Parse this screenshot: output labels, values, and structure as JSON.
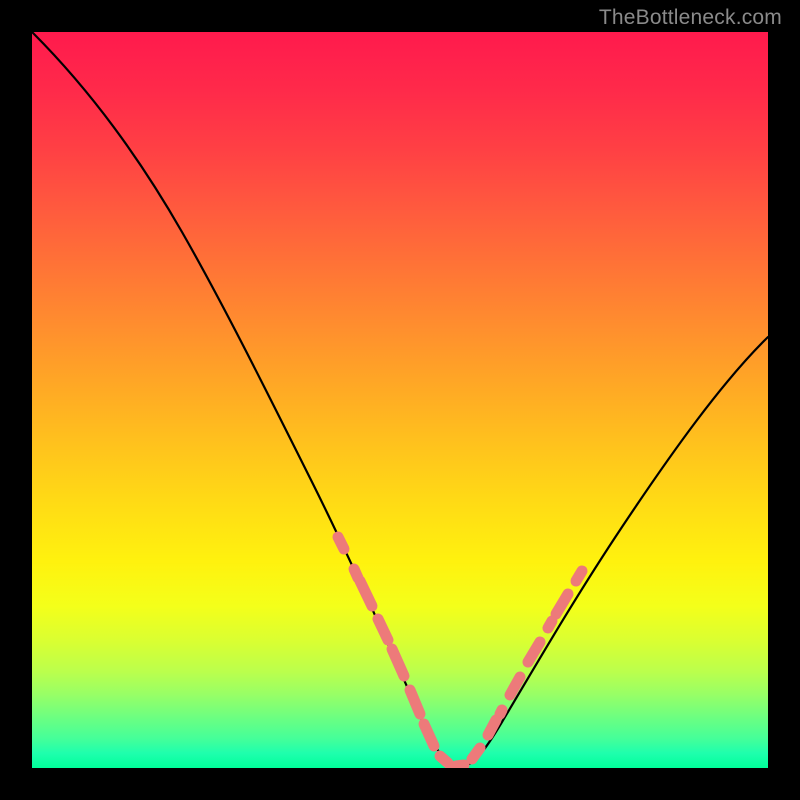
{
  "watermark": "TheBottleneck.com",
  "chart_data": {
    "type": "line",
    "title": "",
    "xlabel": "",
    "ylabel": "",
    "xlim": [
      0,
      100
    ],
    "ylim": [
      0,
      100
    ],
    "grid": false,
    "legend": false,
    "background_gradient": {
      "direction": "vertical",
      "stops": [
        {
          "pos": 0,
          "color": "#ff1a4d"
        },
        {
          "pos": 50,
          "color": "#ffb61f"
        },
        {
          "pos": 75,
          "color": "#fff20e"
        },
        {
          "pos": 100,
          "color": "#00ff9a"
        }
      ]
    },
    "series": [
      {
        "name": "bottleneck-curve",
        "color": "#000000",
        "x": [
          0,
          5,
          10,
          15,
          20,
          25,
          30,
          35,
          40,
          45,
          50,
          52,
          55,
          58,
          60,
          65,
          70,
          75,
          80,
          85,
          90,
          95,
          100
        ],
        "values": [
          100,
          95,
          88,
          80,
          72,
          63,
          54,
          45,
          35,
          23,
          10,
          5,
          1,
          0,
          2,
          8,
          16,
          24,
          32,
          39,
          46,
          52,
          58
        ]
      }
    ],
    "markers": [
      {
        "name": "highlight-dots",
        "color": "#f08080",
        "style": "rounded-dash",
        "x": [
          41,
          43,
          45,
          46,
          48,
          50,
          52,
          54,
          56,
          58,
          60,
          62,
          64,
          66,
          68
        ],
        "values": [
          32,
          27,
          23,
          20,
          14,
          10,
          5,
          2,
          1,
          0,
          2,
          5,
          9,
          12,
          16
        ]
      }
    ]
  }
}
